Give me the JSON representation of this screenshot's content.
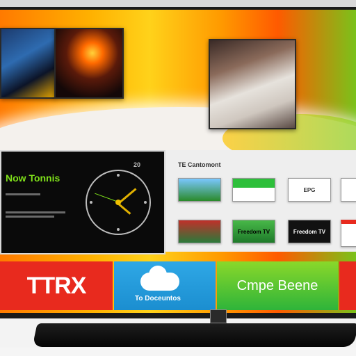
{
  "featured_thumbs": [
    {
      "icon": "city-night-thumbnail"
    },
    {
      "icon": "sunset-thumbnail"
    },
    {
      "icon": "person-thumbnail"
    }
  ],
  "clock_panel": {
    "title": "Now Tonnis",
    "badge": "20"
  },
  "apps_panel": {
    "title": "TE Cantomont",
    "apps": [
      {
        "label": ""
      },
      {
        "label": ""
      },
      {
        "label": "EPG"
      },
      {
        "label": ""
      },
      {
        "label": ""
      },
      {
        "label": "Freedom TV"
      },
      {
        "label": ""
      }
    ]
  },
  "tiles": [
    {
      "label": "TTRX"
    },
    {
      "label": "To Doceuntos"
    },
    {
      "label": "Cmpe Beene"
    }
  ],
  "colors": {
    "accent_red": "#e82a1e",
    "accent_blue": "#2fa8e6",
    "accent_green": "#7ac21a"
  }
}
